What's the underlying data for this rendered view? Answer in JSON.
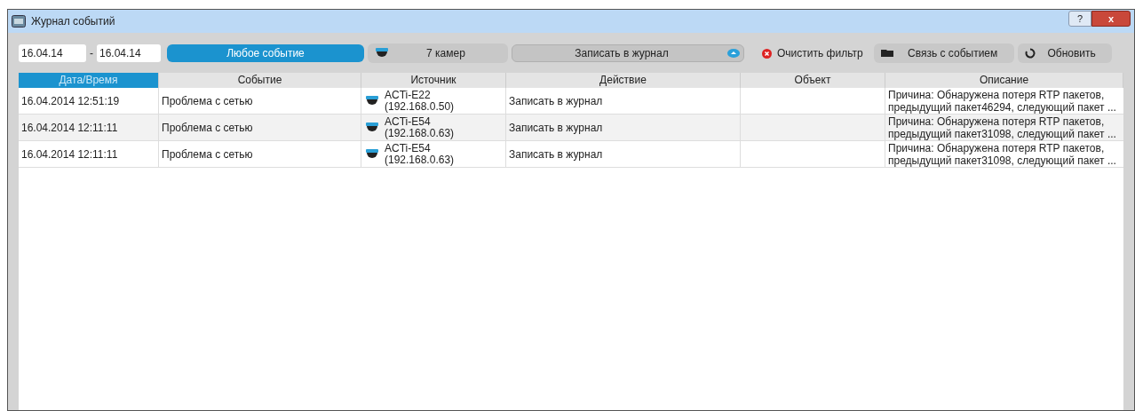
{
  "window": {
    "title": "Журнал событий",
    "help": "?",
    "close": "x"
  },
  "toolbar": {
    "date_from": "16.04.14",
    "date_to": "16.04.14",
    "separator": "-",
    "event_filter": "Любое событие",
    "cameras": "7 камер",
    "action_filter": "Записать в журнал",
    "clear_filter": "Очистить фильтр",
    "link_event": "Связь с событием",
    "refresh": "Обновить"
  },
  "table": {
    "columns": [
      {
        "label": "Дата/Время",
        "selected": true
      },
      {
        "label": "Событие",
        "selected": false
      },
      {
        "label": "Источник",
        "selected": false
      },
      {
        "label": "Действие",
        "selected": false
      },
      {
        "label": "Объект",
        "selected": false
      },
      {
        "label": "Описание",
        "selected": false
      }
    ],
    "rows": [
      {
        "datetime": "16.04.2014 12:51:19",
        "event": "Проблема с сетью",
        "source_name": "ACTi-E22",
        "source_ip": "(192.168.0.50)",
        "action": "Записать в журнал",
        "description": "Причина: Обнаружена потеря RTP пакетов, предыдущий пакет46294, следующий пакет ..."
      },
      {
        "datetime": "16.04.2014 12:11:11",
        "event": "Проблема с сетью",
        "source_name": "ACTi-E54",
        "source_ip": "(192.168.0.63)",
        "action": "Записать в журнал",
        "description": "Причина: Обнаружена потеря RTP пакетов, предыдущий пакет31098, следующий пакет ..."
      },
      {
        "datetime": "16.04.2014 12:11:11",
        "event": "Проблема с сетью",
        "source_name": "ACTi-E54",
        "source_ip": "(192.168.0.63)",
        "action": "Записать в журнал",
        "description": "Причина: Обнаружена потеря RTP пакетов, предыдущий пакет31098, следующий пакет ..."
      }
    ]
  }
}
